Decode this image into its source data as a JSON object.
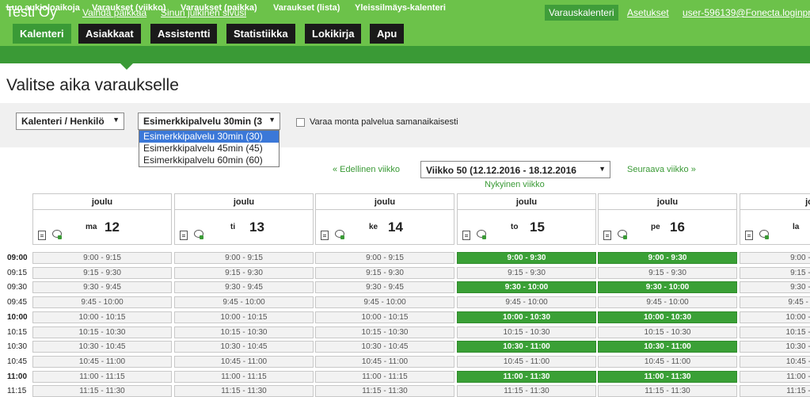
{
  "header": {
    "company": "Testi Oy",
    "links": [
      "Vaihda paikkaa",
      "Sinun julkinen sivusi"
    ],
    "right_button": "Varauskalenteri",
    "settings": "Asetukset",
    "user": "user-596139@Fonecta.loginpro"
  },
  "main_tabs": [
    "Kalenteri",
    "Asiakkaat",
    "Assistentti",
    "Statistiikka",
    "Lokikirja",
    "Apu"
  ],
  "active_tab": "Kalenteri",
  "sub_tabs": [
    "Luo aukioloaikoja",
    "Varaukset (viikko)",
    "Varaukset (paikka)",
    "Varaukset (lista)",
    "Yleissilmäys-kalenteri"
  ],
  "page_title": "Valitse aika varaukselle",
  "filters": {
    "calendar_select": "Kalenteri / Henkilö",
    "service_select": "Esimerkkipalvelu 30min (3",
    "multi_checkbox_label": "Varaa monta palvelua samanaikaisesti",
    "service_options": [
      "Esimerkkipalvelu 30min (30)",
      "Esimerkkipalvelu 45min (45)",
      "Esimerkkipalvelu 60min (60)"
    ]
  },
  "week_nav": {
    "prev": "« Edellinen viikko",
    "week": "Viikko 50 (12.12.2016 - 18.12.2016",
    "next": "Seuraava viikko »",
    "current": "Nykyinen viikko"
  },
  "days": [
    {
      "month": "joulu",
      "name": "ma",
      "num": "12"
    },
    {
      "month": "joulu",
      "name": "ti",
      "num": "13"
    },
    {
      "month": "joulu",
      "name": "ke",
      "num": "14"
    },
    {
      "month": "joulu",
      "name": "to",
      "num": "15"
    },
    {
      "month": "joulu",
      "name": "pe",
      "num": "16"
    },
    {
      "month": "jo",
      "name": "la",
      "num": ""
    }
  ],
  "times": [
    "09:00",
    "09:15",
    "09:30",
    "09:45",
    "10:00",
    "10:15",
    "10:30",
    "10:45",
    "11:00",
    "11:15"
  ],
  "slots_default": [
    "9:00 - 9:15",
    "9:15 - 9:30",
    "9:30 - 9:45",
    "9:45 - 10:00",
    "10:00 - 10:15",
    "10:15 - 10:30",
    "10:30 - 10:45",
    "10:45 - 11:00",
    "11:00 - 11:15",
    "11:15 - 11:30"
  ],
  "slots_available": [
    "9:00 - 9:30",
    "9:15 - 9:30",
    "9:30 - 10:00",
    "9:45 - 10:00",
    "10:00 - 10:30",
    "10:15 - 10:30",
    "10:30 - 11:00",
    "10:45 - 11:00",
    "11:00 - 11:30",
    "11:15 - 11:30"
  ],
  "available_rows": [
    0,
    2,
    4,
    6,
    8
  ],
  "available_days": [
    3,
    4
  ]
}
